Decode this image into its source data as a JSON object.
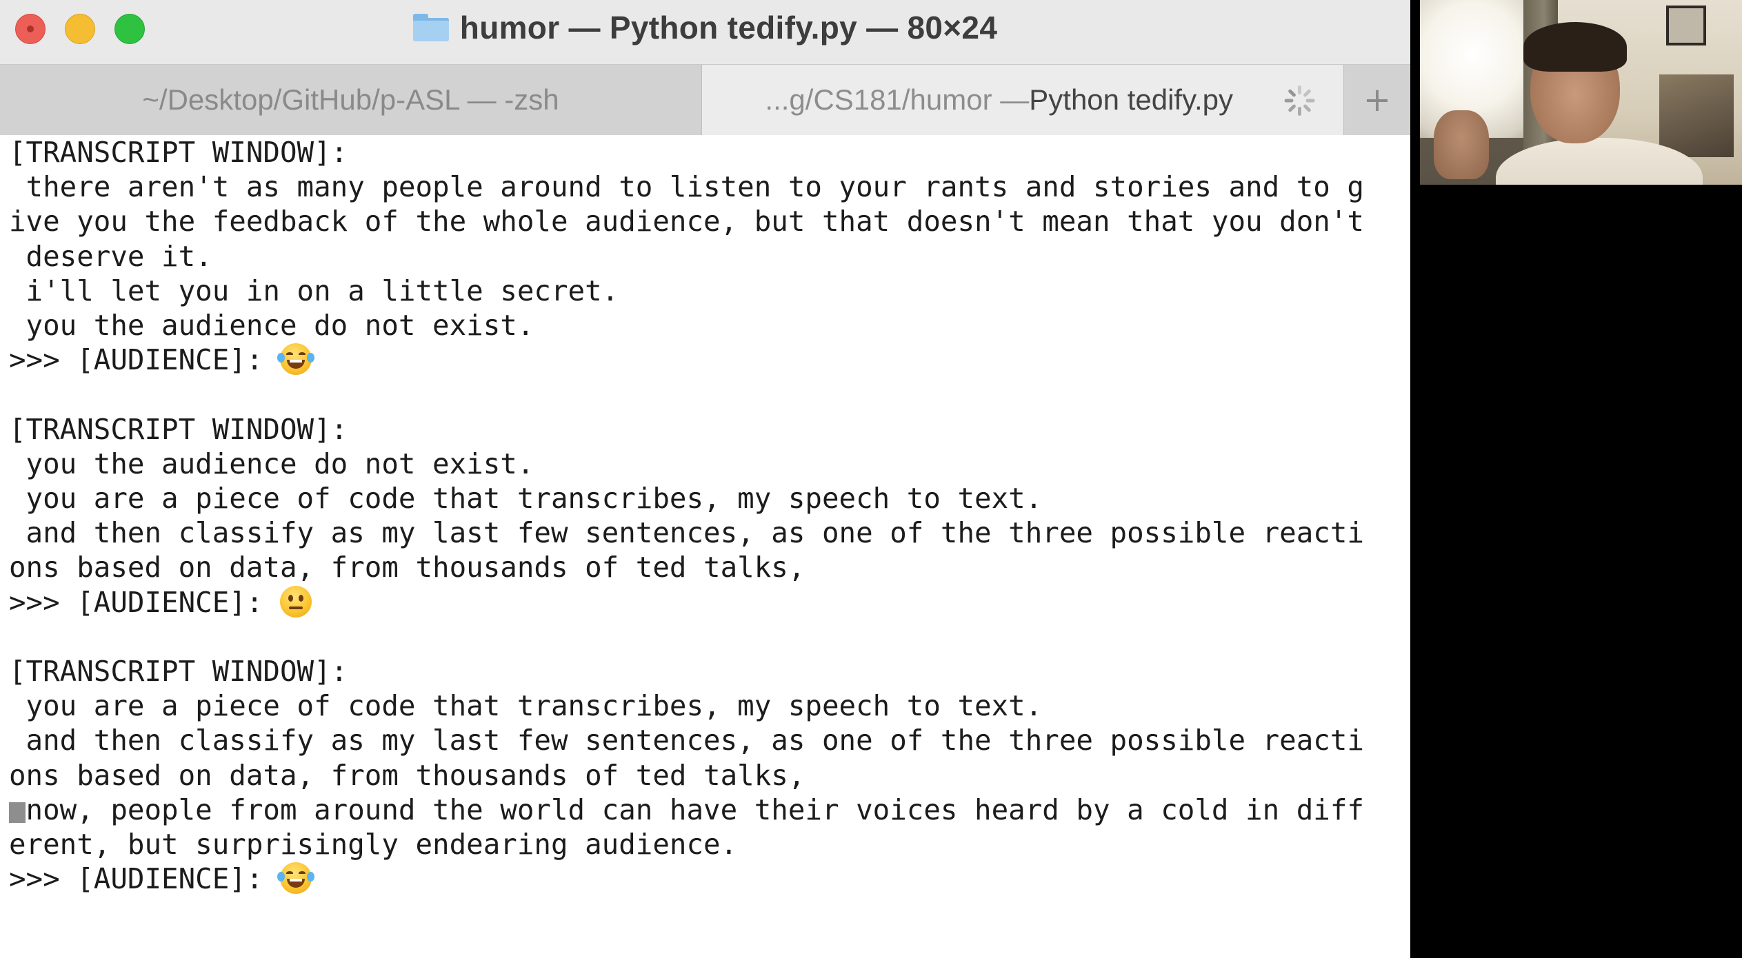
{
  "window": {
    "title": "humor — Python tedify.py — 80×24",
    "tabs": [
      {
        "label": "~/Desktop/GitHub/p-ASL — -zsh",
        "active": false
      },
      {
        "label_dim": "...g/CS181/humor — ",
        "label_strong": "Python tedify.py",
        "active": true
      }
    ],
    "new_tab_label": "+"
  },
  "terminal": {
    "lines": [
      "[TRANSCRIPT WINDOW]:",
      " there aren't as many people around to listen to your rants and stories and to g",
      "ive you the feedback of the whole audience, but that doesn't mean that you don't",
      " deserve it.",
      " i'll let you in on a little secret.",
      " you the audience do not exist.",
      ">>> [AUDIENCE]: ",
      "",
      "[TRANSCRIPT WINDOW]:",
      " you the audience do not exist.",
      " you are a piece of code that transcribes, my speech to text.",
      " and then classify as my last few sentences, as one of the three possible reacti",
      "ons based on data, from thousands of ted talks,",
      ">>> [AUDIENCE]: ",
      "",
      "[TRANSCRIPT WINDOW]:",
      " you are a piece of code that transcribes, my speech to text.",
      " and then classify as my last few sentences, as one of the three possible reacti",
      "ons based on data, from thousands of ted talks,",
      " now, people from around the world can have their voices heard by a cold in diff",
      "erent, but surprisingly endearing audience.",
      ">>> [AUDIENCE]: "
    ],
    "reactions": [
      {
        "emoji": "face-with-tears-of-joy"
      },
      {
        "emoji": "neutral-face"
      },
      {
        "emoji": "face-with-tears-of-joy"
      }
    ]
  },
  "webcam": {
    "content": "presenter video feed"
  },
  "colors": {
    "close": "#ec5f57",
    "minimize": "#f5bd31",
    "maximize": "#2fc140",
    "terminal_bg": "#ffffff",
    "text": "#1c1c1c"
  }
}
